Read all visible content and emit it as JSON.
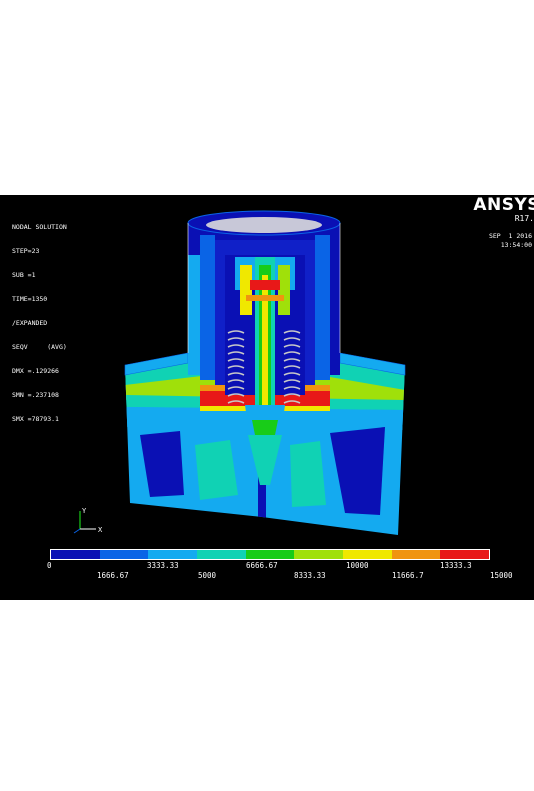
{
  "info": {
    "lines": [
      "NODAL SOLUTION",
      "STEP=23",
      "SUB =1",
      "TIME=1350",
      "/EXPANDED",
      "SEQV     (AVG)",
      "DMX =.129266",
      "SMN =.237108",
      "SMX =78793.1"
    ]
  },
  "brand": {
    "name": "ANSYS",
    "release": "R17.",
    "date": "SEP  1 2016",
    "time": "13:54:00"
  },
  "triad": {
    "y": "Y",
    "x": "X"
  },
  "legend": {
    "colors": [
      "#0a10b4",
      "#0a64e6",
      "#14aaf0",
      "#10d2b4",
      "#18cc18",
      "#a0e00a",
      "#f0e800",
      "#f09410",
      "#e81818"
    ],
    "upper_labels": [
      "0",
      "3333.33",
      "6666.67",
      "10000",
      "13333.3"
    ],
    "lower_labels": [
      "1666.67",
      "5000",
      "8333.33",
      "11666.7",
      "15000"
    ]
  }
}
